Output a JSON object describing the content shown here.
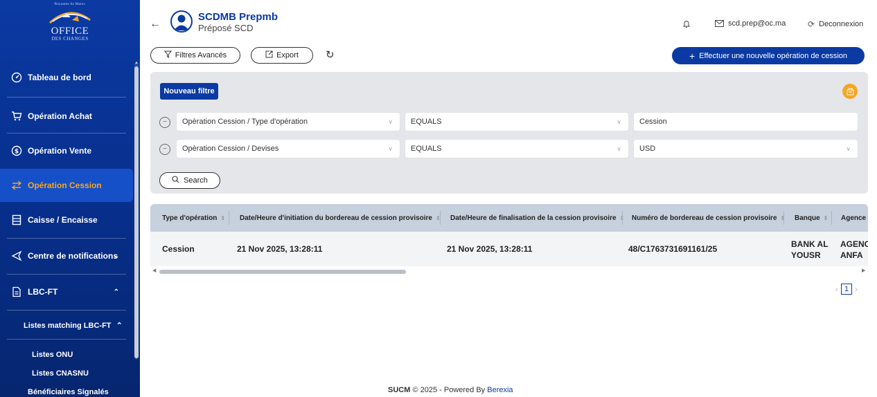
{
  "logo": {
    "top_text": "Royaume du Maroc",
    "name": "OFFICE",
    "sub": "DES CHANGES"
  },
  "sidebar": {
    "items": [
      {
        "label": "Tableau de bord",
        "icon": "dashboard-gauge-icon"
      },
      {
        "label": "Opération Achat",
        "icon": "cart-icon"
      },
      {
        "label": "Opération Vente",
        "icon": "dollar-circle-icon"
      },
      {
        "label": "Opération Cession",
        "icon": "swap-arrows-icon",
        "active": true
      },
      {
        "label": "Caisse / Encaisse",
        "icon": "cash-register-icon"
      },
      {
        "label": "Centre de notifications",
        "icon": "send-icon",
        "expand": "⌄"
      },
      {
        "label": "LBC-FT",
        "icon": "document-icon",
        "expand": "⌃"
      }
    ],
    "submenu_group": {
      "label": "Listes matching LBC-FT",
      "expand": "⌃"
    },
    "sub_items": [
      "Listes ONU",
      "Listes CNASNU",
      "Bénéficiaires Signalés"
    ]
  },
  "header": {
    "user_name": "SCDMB Prepmb",
    "user_role": "Préposé SCD",
    "email": "scd.prep@oc.ma",
    "logout": "Deconnexion"
  },
  "toolbar": {
    "filters_label": "Filtres Avancés",
    "export_label": "Export",
    "new_operation_label": "Effectuer une nouvelle opération de cession"
  },
  "filters": {
    "new_filter_label": "Nouveau filtre",
    "rows": [
      {
        "field": "Opèration Cession / Type d'opération",
        "operator": "EQUALS",
        "value": "Cession"
      },
      {
        "field": "Opèration Cession / Devises",
        "operator": "EQUALS",
        "value": "USD"
      }
    ],
    "search_label": "Search"
  },
  "table": {
    "columns": [
      "Type d'opération",
      "Date/Heure d'initiation du bordereau de cession provisoire",
      "Date/Heure de finalisation de la cession provisoire",
      "Numéro de bordereau de cession provisoire",
      "Banque",
      "Agence"
    ],
    "rows": [
      {
        "type": "Cession",
        "init_date": "21 Nov 2025, 13:28:11",
        "final_date": "21 Nov 2025, 13:28:11",
        "numero": "48/C1763731691161/25",
        "banque_line1": "BANK AL",
        "banque_line2": "YOUSR",
        "agence_line1": "AGENC",
        "agence_line2": "ANFA"
      }
    ]
  },
  "pagination": {
    "current_page": "1"
  },
  "footer": {
    "brand": "SUCM",
    "text": "© 2025 - Powered By",
    "company": "Berexia"
  },
  "colors": {
    "primary": "#0b3aa3",
    "accent": "#f4a623",
    "panel": "#e4e6ea",
    "table_header": "#c7d0dd"
  }
}
